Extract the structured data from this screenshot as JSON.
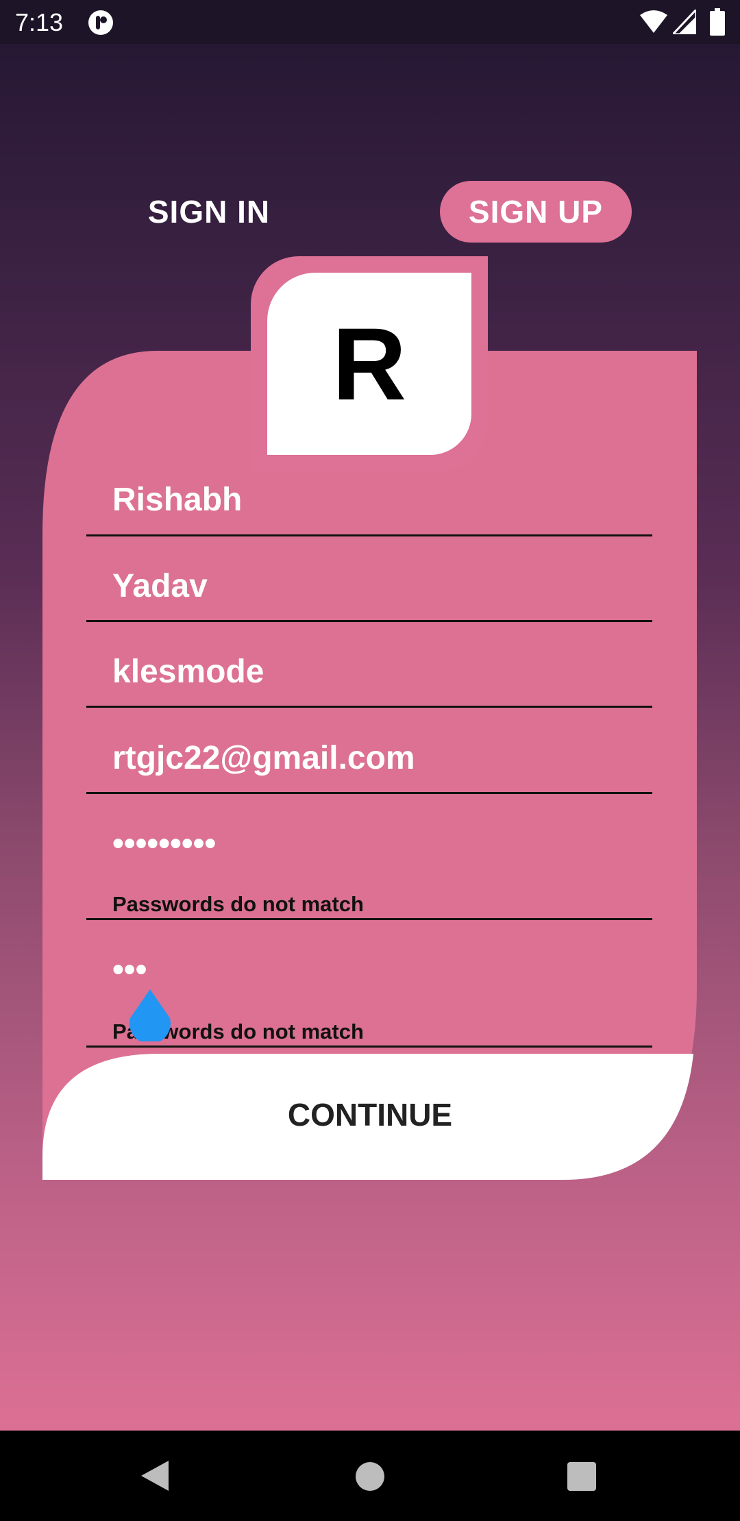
{
  "status_bar": {
    "time": "7:13",
    "icons": [
      "notification-app-icon",
      "wifi-icon",
      "signal-icon",
      "battery-icon"
    ]
  },
  "tabs": {
    "sign_in": "SIGN IN",
    "sign_up": "SIGN UP",
    "active": "sign_up"
  },
  "logo": {
    "letter": "R"
  },
  "form": {
    "first_name": "Rishabh",
    "last_name": "Yadav",
    "username": "klesmode",
    "email": "rtgjc22@gmail.com",
    "password": "•••••••••",
    "password_error": "Passwords do not match",
    "confirm_password": "•••",
    "confirm_password_error": "Passwords do not match"
  },
  "continue_label": "CONTINUE",
  "colors": {
    "accent_pink": "#dd7196",
    "status_bar": "#1d1428",
    "cursor_handle": "#2196f3"
  },
  "nav_bar": {
    "icons": [
      "back-icon",
      "home-icon",
      "recents-icon"
    ]
  }
}
